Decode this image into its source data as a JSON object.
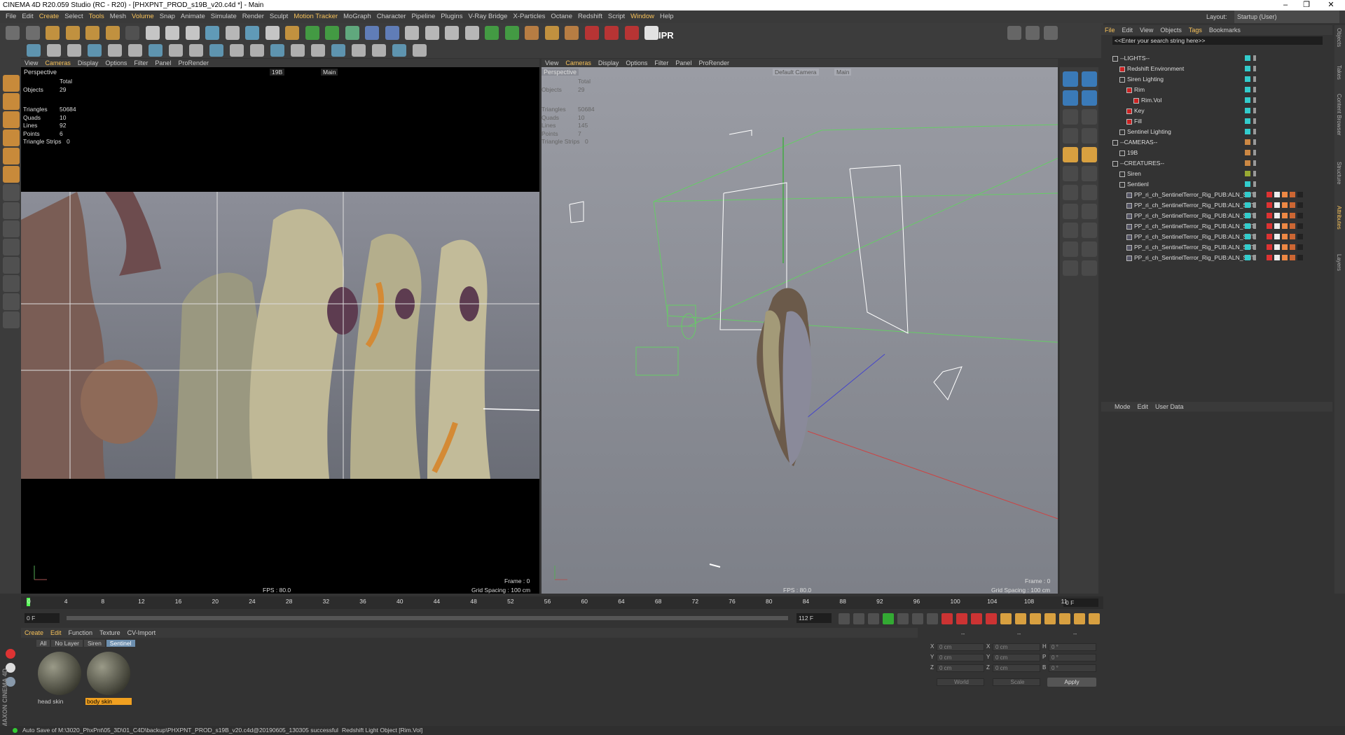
{
  "window": {
    "title": "CINEMA 4D R20.059 Studio (RC - R20) - [PHXPNT_PROD_s19B_v20.c4d *] - Main",
    "minimize": "–",
    "maximize": "❐",
    "close": "✕"
  },
  "menu": [
    "File",
    "Edit",
    "Create",
    "Select",
    "Tools",
    "Mesh",
    "Volume",
    "Snap",
    "Animate",
    "Simulate",
    "Render",
    "Sculpt",
    "Motion Tracker",
    "MoGraph",
    "Character",
    "Pipeline",
    "Plugins",
    "V-Ray Bridge",
    "X-Particles",
    "Octane",
    "Redshift",
    "Script",
    "Window",
    "Help"
  ],
  "menu_highlight": [
    2,
    4,
    6,
    12,
    22
  ],
  "layout": {
    "label": "Layout:",
    "value": "Startup (User)"
  },
  "toolbar": {
    "ipr": "IPR"
  },
  "viewport_left": {
    "menu": [
      "View",
      "Cameras",
      "Display",
      "Options",
      "Filter",
      "Panel",
      "ProRender"
    ],
    "name": "Perspective",
    "camera": "19B",
    "view": "Main",
    "stats": {
      "total_label": "Total",
      "objects_label": "Objects",
      "objects": "29",
      "triangles_label": "Triangles",
      "triangles": "50684",
      "quads_label": "Quads",
      "quads": "10",
      "lines_label": "Lines",
      "lines": "92",
      "points_label": "Points",
      "points": "6",
      "strips_label": "Triangle Strips",
      "strips": "0"
    },
    "fps": "FPS : 80.0",
    "frame": "Frame : 0",
    "grid": "Grid Spacing : 100 cm"
  },
  "viewport_right": {
    "menu": [
      "View",
      "Cameras",
      "Display",
      "Options",
      "Filter",
      "Panel",
      "ProRender"
    ],
    "name": "Perspective",
    "camera": "Default Camera",
    "view": "Main",
    "stats": {
      "total_label": "Total",
      "objects_label": "Objects",
      "objects": "29",
      "triangles_label": "Triangles",
      "triangles": "50684",
      "quads_label": "Quads",
      "quads": "10",
      "lines_label": "Lines",
      "lines": "145",
      "points_label": "Points",
      "points": "7",
      "strips_label": "Triangle Strips",
      "strips": "0"
    },
    "fps": "FPS : 80.0",
    "frame": "Frame : 0",
    "grid": "Grid Spacing : 100 cm"
  },
  "object_manager": {
    "menu": [
      "File",
      "Edit",
      "View",
      "Objects",
      "Tags",
      "Bookmarks"
    ],
    "search": "<<Enter your search string here>>",
    "rows": [
      {
        "name": "--LIGHTS--",
        "indent": 0
      },
      {
        "name": "Redshift Environment",
        "indent": 1
      },
      {
        "name": "Siren Lighting",
        "indent": 1
      },
      {
        "name": "Rim",
        "indent": 2
      },
      {
        "name": "Rim.Vol",
        "indent": 3
      },
      {
        "name": "Key",
        "indent": 2
      },
      {
        "name": "Fill",
        "indent": 2
      },
      {
        "name": "Sentinel Lighting",
        "indent": 1
      },
      {
        "name": "--CAMERAS--",
        "indent": 0
      },
      {
        "name": "19B",
        "indent": 1
      },
      {
        "name": "--CREATURES--",
        "indent": 0
      },
      {
        "name": "Siren",
        "indent": 1
      },
      {
        "name": "Sentienl",
        "indent": 1
      },
      {
        "name": "PP_ri_ch_SentinelTerror_Rig_PUB:ALN_SNT",
        "indent": 2
      },
      {
        "name": "PP_ri_ch_SentinelTerror_Rig_PUB:ALN_SNT",
        "indent": 2
      },
      {
        "name": "PP_ri_ch_SentinelTerror_Rig_PUB:ALN_SNT",
        "indent": 2
      },
      {
        "name": "PP_ri_ch_SentinelTerror_Rig_PUB:ALN_SNT",
        "indent": 2
      },
      {
        "name": "PP_ri_ch_SentinelTerror_Rig_PUB:ALN_SNT",
        "indent": 2
      },
      {
        "name": "PP_ri_ch_SentinelTerror_Rig_PUB:ALN_SNT",
        "indent": 2
      },
      {
        "name": "PP_ri_ch_SentinelTerror_Rig_PUB:ALN_SNT",
        "indent": 2
      }
    ]
  },
  "attributes": {
    "menu": [
      "Mode",
      "Edit",
      "User Data"
    ]
  },
  "side_tabs": [
    "Objects",
    "Takes",
    "Content Browser",
    "Structure",
    "Attributes",
    "Layers"
  ],
  "timeline": {
    "ticks": [
      "0",
      "4",
      "8",
      "12",
      "16",
      "20",
      "24",
      "28",
      "32",
      "36",
      "40",
      "44",
      "48",
      "52",
      "56",
      "60",
      "64",
      "68",
      "72",
      "76",
      "80",
      "84",
      "88",
      "92",
      "96",
      "100",
      "104",
      "108",
      "11"
    ],
    "current_frame": "0 F",
    "end_display": "0 F",
    "start": "0 F",
    "end": "112 F",
    "range_end_label": "112 F"
  },
  "material_manager": {
    "menu": [
      "Create",
      "Edit",
      "Function",
      "Texture",
      "CV-Import"
    ],
    "filters": [
      "All",
      "No Layer",
      "Siren",
      "Sentinel"
    ],
    "materials": [
      {
        "name": "head skin",
        "selected": false
      },
      {
        "name": "body skin",
        "selected": true
      }
    ]
  },
  "coordinates": {
    "labels_a": [
      "X",
      "Y",
      "Z"
    ],
    "labels_b": [
      "X",
      "Y",
      "Z"
    ],
    "labels_c": [
      "H",
      "P",
      "B"
    ],
    "pos": [
      "0 cm",
      "0 cm",
      "0 cm"
    ],
    "size": [
      "0 cm",
      "0 cm",
      "0 cm"
    ],
    "rot": [
      "0 °",
      "0 °",
      "0 °"
    ],
    "mode1": "World",
    "mode2": "Scale",
    "apply": "Apply",
    "header1": "--",
    "header2": "--",
    "header3": "--"
  },
  "status": {
    "left": "Auto Save of M:\\3020_PhxPnt\\05_3D\\01_C4D\\backup\\PHXPNT_PROD_s19B_v20.c4d@20190605_130305 successful",
    "right": "Redshift Light Object [Rim.Vol]"
  },
  "branding": "MAXON CINEMA 4D"
}
